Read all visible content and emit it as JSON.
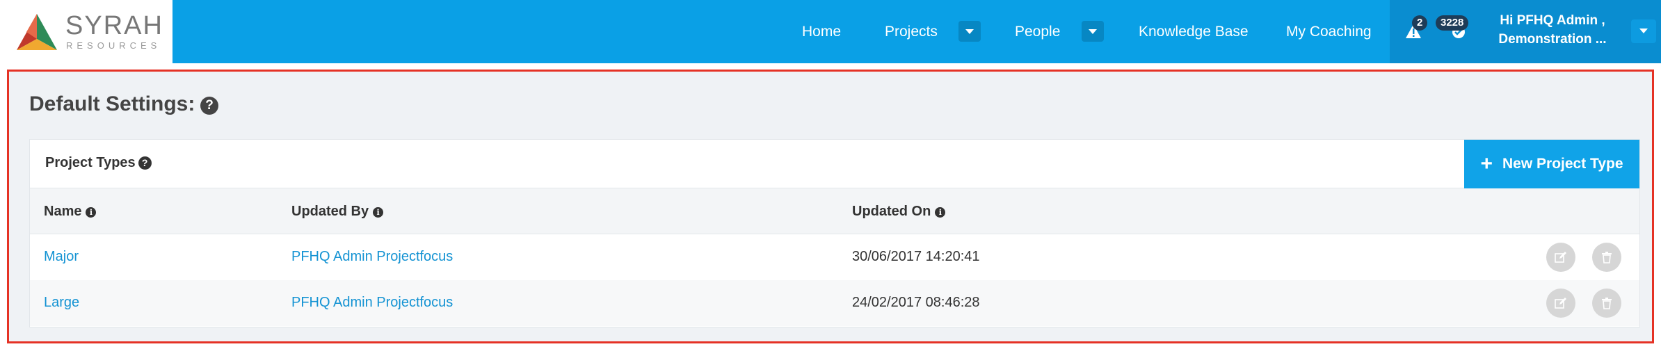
{
  "brand": {
    "name": "SYRAH",
    "sub": "RESOURCES"
  },
  "nav": {
    "home": "Home",
    "projects": "Projects",
    "people": "People",
    "knowledge_base": "Knowledge Base",
    "my_coaching": "My Coaching"
  },
  "notifications": {
    "alerts_count": "2",
    "messages_count": "3228"
  },
  "user": {
    "greeting_line1": "Hi PFHQ Admin ,",
    "greeting_line2": "Demonstration ..."
  },
  "page": {
    "title": "Default Settings:",
    "help": "?"
  },
  "panel": {
    "title": "Project Types",
    "help": "?",
    "new_button": "New Project Type",
    "columns": {
      "name": "Name",
      "updated_by": "Updated By",
      "updated_on": "Updated On"
    },
    "rows": [
      {
        "name": "Major",
        "updated_by": "PFHQ Admin Projectfocus",
        "updated_on": "30/06/2017 14:20:41"
      },
      {
        "name": "Large",
        "updated_by": "PFHQ Admin Projectfocus",
        "updated_on": "24/02/2017 08:46:28"
      }
    ]
  },
  "colors": {
    "nav_bg": "#0aa0e6",
    "link": "#1493d3",
    "highlight_border": "#e53225"
  }
}
